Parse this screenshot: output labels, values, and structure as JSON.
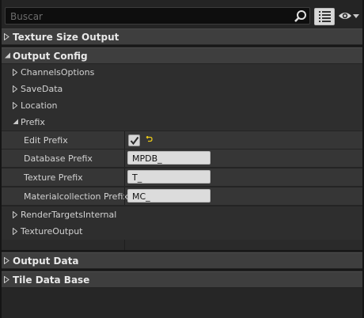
{
  "search": {
    "placeholder": "Buscar"
  },
  "icons": {
    "search": "magnifier-icon",
    "view_options": "list-view-icon",
    "visibility": "eye-icon"
  },
  "categories": {
    "texture_size_output": "Texture Size Output",
    "output_config": "Output Config",
    "output_data": "Output Data",
    "tile_data_base": "Tile Data Base"
  },
  "output_config": {
    "channels_options": "ChannelsOptions",
    "save_data": "SaveData",
    "location": "Location",
    "prefix": "Prefix",
    "render_targets_internal": "RenderTargetsInternal",
    "texture_output": "TextureOutput"
  },
  "prefix": {
    "edit_prefix_label": "Edit Prefix",
    "edit_prefix_checked": true,
    "database_prefix_label": "Database Prefix",
    "database_prefix_value": "MPDB_",
    "texture_prefix_label": "Texture Prefix",
    "texture_prefix_value": "T_",
    "materialcollection_prefix_label": "Materialcollection Prefix",
    "materialcollection_prefix_value": "MC_"
  },
  "colors": {
    "reset_arrow": "#e8c81a",
    "panel_bg": "#242424",
    "category_bg": "#3e3e3e"
  }
}
